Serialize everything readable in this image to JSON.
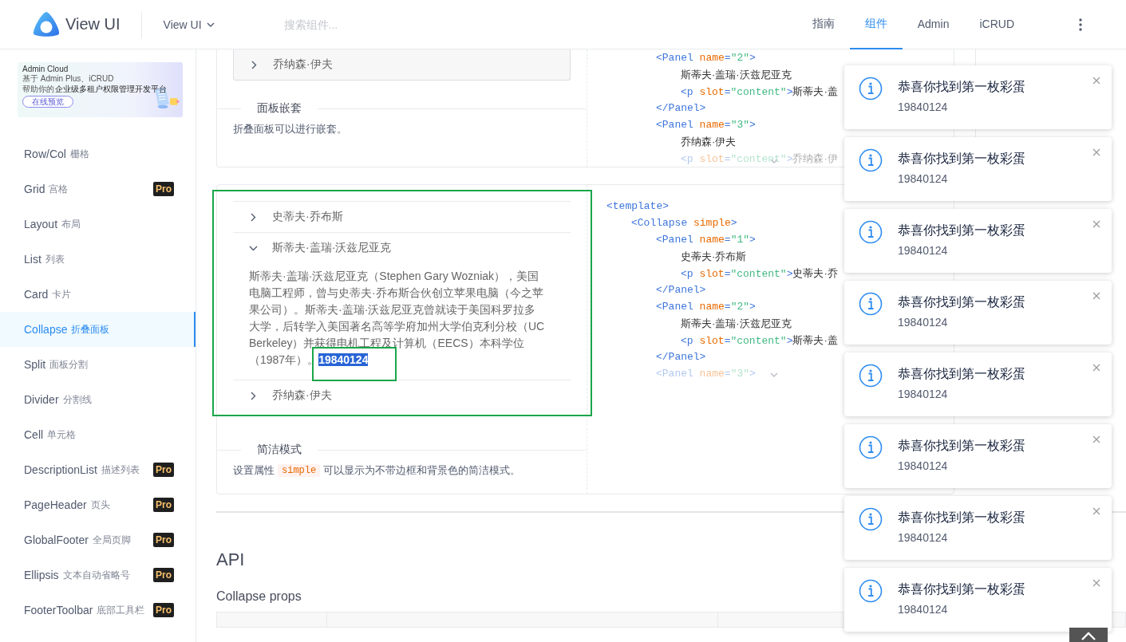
{
  "header": {
    "logo_text": "View UI",
    "product_menu": "View UI",
    "search": {
      "placeholder": "搜索组件..."
    },
    "nav": [
      {
        "label": "指南",
        "selected": false
      },
      {
        "label": "组件",
        "selected": true
      },
      {
        "label": "Admin",
        "selected": false
      },
      {
        "label": "iCRUD",
        "selected": false
      }
    ]
  },
  "sidebar": {
    "banner": {
      "title": "Admin Cloud",
      "line_1": "基于 Admin Plus、iCRUD",
      "line_2_lead": "帮助你的",
      "line_2": "企业级多租户权限管理开发平台",
      "button": "在线预览"
    },
    "items": [
      {
        "label": "Row/Col",
        "sublabel": "栅格",
        "selected": false
      },
      {
        "label": "Grid",
        "sublabel": "宫格",
        "badge": "Pro",
        "selected": false
      },
      {
        "label": "Layout",
        "sublabel": "布局",
        "selected": false
      },
      {
        "label": "List",
        "sublabel": "列表",
        "selected": false
      },
      {
        "label": "Card",
        "sublabel": "卡片",
        "selected": false
      },
      {
        "label": "Collapse",
        "sublabel": "折叠面板",
        "selected": true
      },
      {
        "label": "Split",
        "sublabel": "面板分割",
        "selected": false
      },
      {
        "label": "Divider",
        "sublabel": "分割线",
        "selected": false
      },
      {
        "label": "Cell",
        "sublabel": "单元格",
        "selected": false
      },
      {
        "label": "DescriptionList",
        "sublabel": "描述列表",
        "badge": "Pro",
        "selected": false
      },
      {
        "label": "PageHeader",
        "sublabel": "页头",
        "badge": "Pro",
        "selected": false
      },
      {
        "label": "GlobalFooter",
        "sublabel": "全局页脚",
        "badge": "Pro",
        "selected": false
      },
      {
        "label": "Ellipsis",
        "sublabel": "文本自动省略号",
        "badge": "Pro",
        "selected": false
      },
      {
        "label": "FooterToolbar",
        "sublabel": "底部工具栏",
        "badge": "Pro",
        "selected": false
      }
    ]
  },
  "demos": [
    {
      "kind": "nested",
      "panels": [
        {
          "title": "乔纳森·伊夫",
          "expanded": false
        }
      ],
      "legend": "面板嵌套",
      "description": [
        {
          "kind": "text",
          "text": "折叠面板可以进行嵌套。"
        }
      ],
      "code": [
        {
          "faded": false,
          "tokens": [
            {
              "kind": "tag",
              "text": "<Panel"
            },
            {
              "kind": "attr",
              "text": " name"
            },
            {
              "kind": "tag",
              "text": "="
            },
            {
              "kind": "string",
              "text": "\"2\""
            },
            {
              "kind": "tag",
              "text": ">"
            }
          ],
          "children": [
            {
              "faded": false,
              "tokens": [
                {
                  "kind": "plain",
                  "text": "斯蒂夫·盖瑞·沃兹尼亚克"
                }
              ]
            },
            {
              "faded": false,
              "tokens": [
                {
                  "kind": "tag",
                  "text": "<p"
                },
                {
                  "kind": "attr",
                  "text": " slot"
                },
                {
                  "kind": "tag",
                  "text": "="
                },
                {
                  "kind": "string",
                  "text": "\"content\""
                },
                {
                  "kind": "tag",
                  "text": ">"
                },
                {
                  "kind": "plain",
                  "text": "斯蒂夫·盖"
                }
              ]
            }
          ]
        },
        {
          "faded": false,
          "tokens": [
            {
              "kind": "tag",
              "text": "</Panel>"
            }
          ]
        },
        {
          "faded": false,
          "tokens": [
            {
              "kind": "tag",
              "text": "<Panel"
            },
            {
              "kind": "attr",
              "text": " name"
            },
            {
              "kind": "tag",
              "text": "="
            },
            {
              "kind": "string",
              "text": "\"3\""
            },
            {
              "kind": "tag",
              "text": ">"
            }
          ],
          "children": [
            {
              "faded": false,
              "tokens": [
                {
                  "kind": "plain",
                  "text": "乔纳森·伊夫"
                }
              ]
            },
            {
              "faded": true,
              "tokens": [
                {
                  "kind": "tag",
                  "text": "<p"
                },
                {
                  "kind": "attr",
                  "text": " slot"
                },
                {
                  "kind": "tag",
                  "text": "="
                },
                {
                  "kind": "string",
                  "text": "\"content\""
                },
                {
                  "kind": "tag",
                  "text": ">"
                },
                {
                  "kind": "plain",
                  "text": "乔纳森·伊"
                }
              ]
            }
          ]
        }
      ]
    },
    {
      "kind": "simple",
      "panels": [
        {
          "title": "史蒂夫·乔布斯",
          "expanded": false
        },
        {
          "title": "斯蒂夫·盖瑞·沃兹尼亚克",
          "expanded": true,
          "content": "斯蒂夫·盖瑞·沃兹尼亚克（Stephen Gary Wozniak），美国电脑工程师，曾与史蒂夫·乔布斯合伙创立苹果电脑（今之苹果公司）。斯蒂夫·盖瑞·沃兹尼亚克曾就读于美国科罗拉多大学，后转学入美国著名高等学府加州大学伯克利分校（UC Berkeley）并获得电机工程及计算机（EECS）本科学位（1987年）。",
          "selected_text": "19840124"
        },
        {
          "title": "乔纳森·伊夫",
          "expanded": false
        }
      ],
      "legend": "简洁模式",
      "description": [
        {
          "kind": "text",
          "text": "设置属性"
        },
        {
          "kind": "code",
          "text": "simple"
        },
        {
          "kind": "text",
          "text": "可以显示为不带边框和背景色的简洁模式。"
        }
      ],
      "code": [
        {
          "faded": false,
          "tokens": [
            {
              "kind": "tag",
              "text": "<template>"
            }
          ],
          "children": [
            {
              "faded": false,
              "tokens": [
                {
                  "kind": "tag",
                  "text": "<Collapse"
                },
                {
                  "kind": "attr",
                  "text": " simple"
                },
                {
                  "kind": "tag",
                  "text": ">"
                }
              ],
              "children": [
                {
                  "faded": false,
                  "tokens": [
                    {
                      "kind": "tag",
                      "text": "<Panel"
                    },
                    {
                      "kind": "attr",
                      "text": " name"
                    },
                    {
                      "kind": "tag",
                      "text": "="
                    },
                    {
                      "kind": "string",
                      "text": "\"1\""
                    },
                    {
                      "kind": "tag",
                      "text": ">"
                    }
                  ],
                  "children": [
                    {
                      "faded": false,
                      "tokens": [
                        {
                          "kind": "plain",
                          "text": "史蒂夫·乔布斯"
                        }
                      ]
                    },
                    {
                      "faded": false,
                      "tokens": [
                        {
                          "kind": "tag",
                          "text": "<p"
                        },
                        {
                          "kind": "attr",
                          "text": " slot"
                        },
                        {
                          "kind": "tag",
                          "text": "="
                        },
                        {
                          "kind": "string",
                          "text": "\"content\""
                        },
                        {
                          "kind": "tag",
                          "text": ">"
                        },
                        {
                          "kind": "plain",
                          "text": "史蒂夫·乔"
                        }
                      ]
                    }
                  ]
                },
                {
                  "faded": false,
                  "tokens": [
                    {
                      "kind": "tag",
                      "text": "</Panel>"
                    }
                  ]
                },
                {
                  "faded": false,
                  "tokens": [
                    {
                      "kind": "tag",
                      "text": "<Panel"
                    },
                    {
                      "kind": "attr",
                      "text": " name"
                    },
                    {
                      "kind": "tag",
                      "text": "="
                    },
                    {
                      "kind": "string",
                      "text": "\"2\""
                    },
                    {
                      "kind": "tag",
                      "text": ">"
                    }
                  ],
                  "children": [
                    {
                      "faded": false,
                      "tokens": [
                        {
                          "kind": "plain",
                          "text": "斯蒂夫·盖瑞·沃兹尼亚克"
                        }
                      ]
                    },
                    {
                      "faded": false,
                      "tokens": [
                        {
                          "kind": "tag",
                          "text": "<p"
                        },
                        {
                          "kind": "attr",
                          "text": " slot"
                        },
                        {
                          "kind": "tag",
                          "text": "="
                        },
                        {
                          "kind": "string",
                          "text": "\"content\""
                        },
                        {
                          "kind": "tag",
                          "text": ">"
                        },
                        {
                          "kind": "plain",
                          "text": "斯蒂夫·盖"
                        }
                      ]
                    }
                  ]
                },
                {
                  "faded": false,
                  "tokens": [
                    {
                      "kind": "tag",
                      "text": "</Panel>"
                    }
                  ]
                },
                {
                  "faded": true,
                  "tokens": [
                    {
                      "kind": "tag",
                      "text": "<Panel"
                    },
                    {
                      "kind": "attr",
                      "text": " name"
                    },
                    {
                      "kind": "tag",
                      "text": "="
                    },
                    {
                      "kind": "string",
                      "text": "\"3\""
                    },
                    {
                      "kind": "tag",
                      "text": ">"
                    }
                  ]
                }
              ]
            }
          ]
        }
      ]
    }
  ],
  "api": {
    "title": "API",
    "subtitle": "Collapse props"
  },
  "notifications": [
    {
      "title": "恭喜你找到第一枚彩蛋",
      "description": "19840124"
    },
    {
      "title": "恭喜你找到第一枚彩蛋",
      "description": "19840124"
    },
    {
      "title": "恭喜你找到第一枚彩蛋",
      "description": "19840124"
    },
    {
      "title": "恭喜你找到第一枚彩蛋",
      "description": "19840124"
    },
    {
      "title": "恭喜你找到第一枚彩蛋",
      "description": "19840124"
    },
    {
      "title": "恭喜你找到第一枚彩蛋",
      "description": "19840124"
    },
    {
      "title": "恭喜你找到第一枚彩蛋",
      "description": "19840124"
    },
    {
      "title": "恭喜你找到第一枚彩蛋",
      "description": "19840124"
    }
  ]
}
